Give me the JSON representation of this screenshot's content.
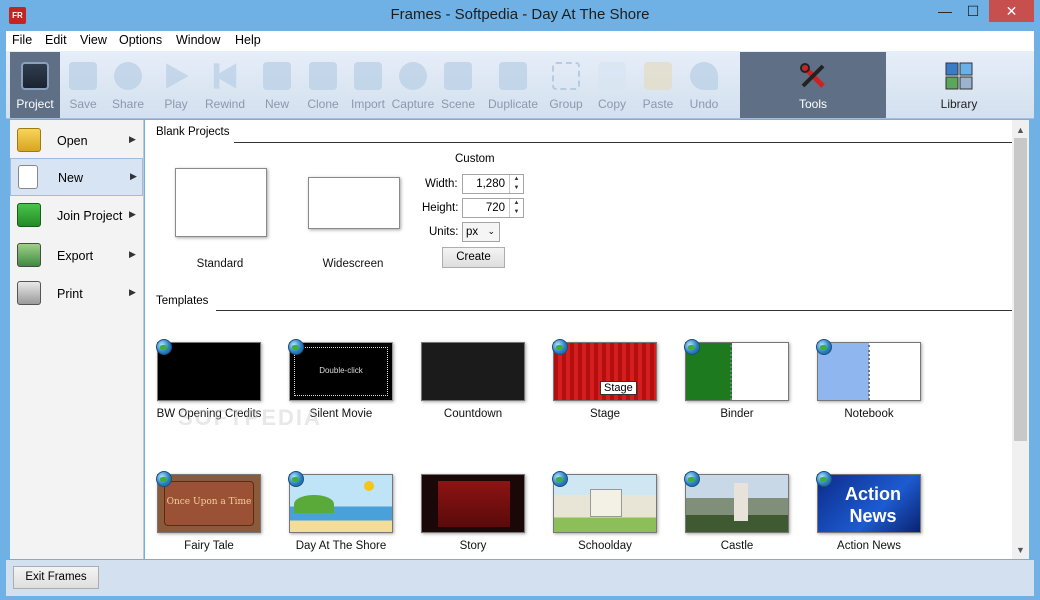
{
  "window": {
    "title": "Frames - Softpedia - Day At The Shore",
    "app_icon_text": "FR",
    "minimize_glyph": "—",
    "maximize_glyph": "☐",
    "close_glyph": "✕"
  },
  "menu": [
    "File",
    "Edit",
    "View",
    "Options",
    "Window",
    "Help"
  ],
  "toolbar": {
    "project": "Project",
    "save": "Save",
    "share": "Share",
    "play": "Play",
    "rewind": "Rewind",
    "new": "New",
    "clone": "Clone",
    "import": "Import",
    "capture": "Capture",
    "scene": "Scene",
    "duplicate": "Duplicate",
    "group": "Group",
    "copy": "Copy",
    "paste": "Paste",
    "undo": "Undo",
    "tools": "Tools",
    "library": "Library"
  },
  "left_panel": {
    "open": "Open",
    "new": "New",
    "join": "Join Project",
    "export": "Export",
    "print": "Print",
    "arrow": "▶"
  },
  "blank_projects": {
    "heading": "Blank Projects",
    "standard": "Standard",
    "widescreen": "Widescreen",
    "custom_heading": "Custom",
    "width_label": "Width:",
    "width_value": "1,280",
    "height_label": "Height:",
    "height_value": "720",
    "units_label": "Units:",
    "units_value": "px",
    "create": "Create"
  },
  "templates": {
    "heading": "Templates",
    "items": [
      "BW Opening Credits",
      "Silent Movie",
      "Countdown",
      "Stage",
      "Binder",
      "Notebook",
      "Fairy Tale",
      "Day At The Shore",
      "Story",
      "Schoolday",
      "Castle",
      "Action News"
    ],
    "silent_movie_text": "Double-click",
    "stage_text": "Stage",
    "fairy_tale_text": "Once Upon a Time",
    "action_news_text": "Action News"
  },
  "exit_button": "Exit Frames",
  "watermark": "SOFTPEDIA",
  "colors": {
    "titlebar": "#6fb1e4",
    "toolbar_active": "#5e6f86",
    "close_button": "#c7504f"
  }
}
